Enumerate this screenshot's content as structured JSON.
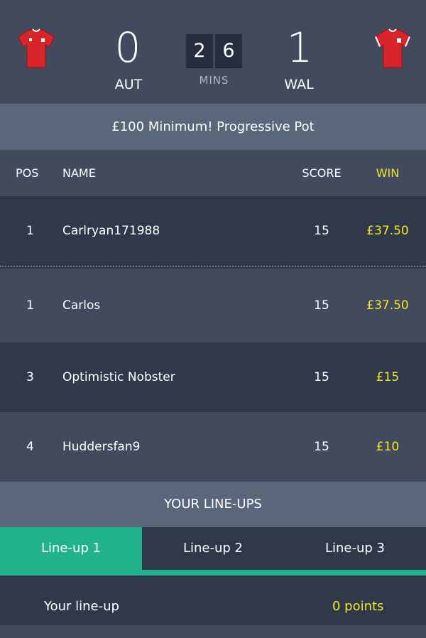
{
  "match": {
    "home_team": "AUT",
    "away_team": "WAL",
    "home_score": "0",
    "away_score": "1",
    "clock_digits": [
      "2",
      "6"
    ],
    "clock_label": "MINS"
  },
  "banner": {
    "text": "£100 Minimum! Progressive Pot"
  },
  "table": {
    "headers": {
      "pos": "POS",
      "name": "NAME",
      "score": "SCORE",
      "win": "WIN"
    },
    "rows": [
      {
        "pos": "1",
        "name": "Carlryan171988",
        "score": "15",
        "win": "£37.50"
      },
      {
        "pos": "1",
        "name": "Carlos",
        "score": "15",
        "win": "£37.50"
      },
      {
        "pos": "3",
        "name": "Optimistic Nobster",
        "score": "15",
        "win": "£15"
      },
      {
        "pos": "4",
        "name": "Huddersfan9",
        "score": "15",
        "win": "£10"
      }
    ]
  },
  "lineups": {
    "title": "YOUR LINE-UPS",
    "tabs": [
      "Line-up 1",
      "Line-up 2",
      "Line-up 3"
    ],
    "active_tab": 0,
    "footer_label": "Your line-up",
    "footer_points": "0 points"
  },
  "icons": {
    "home_shirt": "red-football-shirt-icon",
    "away_shirt": "red-football-shirt-icon"
  },
  "colors": {
    "accent_green": "#21b48c",
    "highlight_yellow": "#f1e629",
    "bg": "#414b5d",
    "row_dark": "#2f394a"
  }
}
